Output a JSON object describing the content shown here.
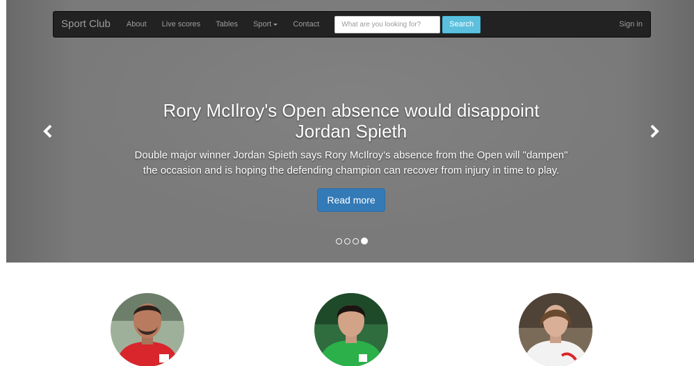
{
  "navbar": {
    "brand": "Sport Club",
    "links": [
      "About",
      "Live scores",
      "Tables"
    ],
    "dropdown_label": "Sport",
    "contact": "Contact",
    "search_placeholder": "What are you looking for?",
    "search_button": "Search",
    "sign_in": "Sign in"
  },
  "carousel": {
    "headline": "Rory McIlroy's Open absence would disappoint Jordan Spieth",
    "description": "Double major winner Jordan Spieth says Rory McIlroy's absence from the Open will \"dampen\" the occasion and is hoping the defending champion can recover from injury in time to play.",
    "read_more": "Read more",
    "slide_count": 4,
    "active_slide": 4,
    "prev_icon": "chevron-left-icon",
    "next_icon": "chevron-right-icon"
  },
  "players": [
    {
      "jersey_color": "#d8262c"
    },
    {
      "jersey_color": "#2bb04a"
    },
    {
      "jersey_color": "#f2f2f2"
    }
  ],
  "colors": {
    "navbar_bg": "#222222",
    "search_button": "#5bc0de",
    "read_more": "#337ab7"
  }
}
